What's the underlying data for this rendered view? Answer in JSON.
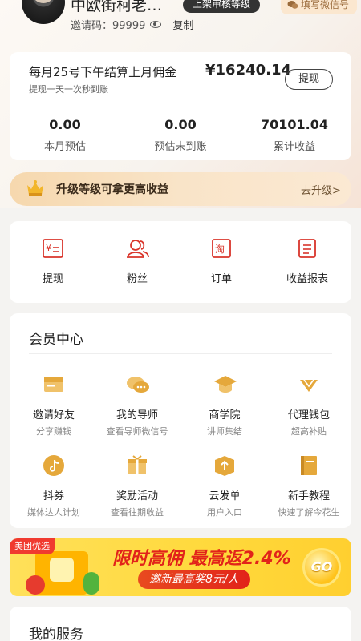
{
  "header": {
    "nickname": "中欧街柯老…",
    "level_badge": "上架审核等级",
    "wechat_button": "填写微信号",
    "invite_label": "邀请码：99999",
    "copy_label": "复制"
  },
  "earnings": {
    "settle_text": "每月25号下午结算上月佣金",
    "amount": "¥16240.14",
    "withdraw_hint": "提现一天一次秒到账",
    "withdraw_button": "提现",
    "stats": [
      {
        "value": "0.00",
        "label": "本月预估"
      },
      {
        "value": "0.00",
        "label": "预估未到账"
      },
      {
        "value": "70101.04",
        "label": "累计收益"
      }
    ]
  },
  "upgrade": {
    "text": "升级等级可拿更高收益",
    "action": "去升级>"
  },
  "quick_actions": [
    {
      "label": "提现",
      "icon": "yen-card-icon"
    },
    {
      "label": "粉丝",
      "icon": "people-icon"
    },
    {
      "label": "订单",
      "icon": "taobao-order-icon"
    },
    {
      "label": "收益报表",
      "icon": "report-icon"
    }
  ],
  "member": {
    "title": "会员中心",
    "items": [
      {
        "label": "邀请好友",
        "sub": "分享赚钱",
        "icon": "invite-icon"
      },
      {
        "label": "我的导师",
        "sub": "查看导师微信号",
        "icon": "chat-icon"
      },
      {
        "label": "商学院",
        "sub": "讲师集结",
        "icon": "graduation-cap-icon"
      },
      {
        "label": "代理钱包",
        "sub": "超高补贴",
        "icon": "wallet-icon"
      },
      {
        "label": "抖券",
        "sub": "媒体达人计划",
        "icon": "tiktok-icon"
      },
      {
        "label": "奖励活动",
        "sub": "查看往期收益",
        "icon": "gift-icon"
      },
      {
        "label": "云发单",
        "sub": "用户入口",
        "icon": "box-upload-icon"
      },
      {
        "label": "新手教程",
        "sub": "快速了解今花生",
        "icon": "book-icon"
      }
    ]
  },
  "banner": {
    "brand": "美团优选",
    "title": "限时高佣 最高返2.4%",
    "subtitle": "邀新最高奖8元/人",
    "go": "GO"
  },
  "service": {
    "title": "我的服务"
  },
  "colors": {
    "accent_red": "#e2231a",
    "icon_red": "#d9352b",
    "gold": "#e8b64c",
    "upgrade_bg": "#f6d8ae"
  }
}
